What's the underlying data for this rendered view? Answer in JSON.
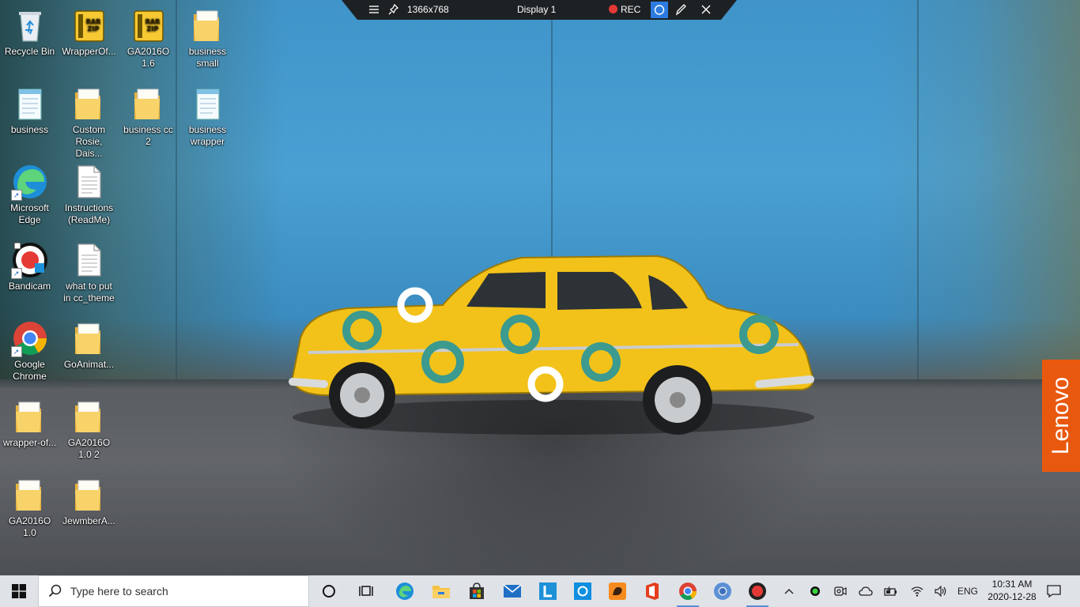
{
  "recorder_bar": {
    "resolution": "1366x768",
    "display": "Display 1",
    "rec_label": "REC"
  },
  "desktop_icons": [
    {
      "label": "Recycle Bin",
      "icon": "recycle-bin-icon"
    },
    {
      "label": "WrapperOf...",
      "icon": "rar-zip-icon"
    },
    {
      "label": "GA2016O 1.6",
      "icon": "rar-zip-icon"
    },
    {
      "label": "business small",
      "icon": "folder-icon"
    },
    {
      "label": "business",
      "icon": "notepad-file-icon"
    },
    {
      "label": "Custom Rosie, Dais...",
      "icon": "folder-icon"
    },
    {
      "label": "business cc 2",
      "icon": "folder-icon"
    },
    {
      "label": "business wrapper",
      "icon": "notepad-file-icon"
    },
    {
      "label": "Microsoft Edge",
      "icon": "edge-icon"
    },
    {
      "label": "Instructions (ReadMe)",
      "icon": "text-file-icon"
    },
    {
      "label": "Bandicam",
      "icon": "bandicam-icon"
    },
    {
      "label": "what to put in cc_theme",
      "icon": "text-file-icon"
    },
    {
      "label": "Google Chrome",
      "icon": "chrome-icon"
    },
    {
      "label": "GoAnimat...",
      "icon": "folder-icon"
    },
    {
      "label": "wrapper-of...",
      "icon": "folder-icon"
    },
    {
      "label": "GA2016O 1.0 2",
      "icon": "folder-icon"
    },
    {
      "label": "GA2016O 1.0",
      "icon": "folder-icon"
    },
    {
      "label": "JewmberA...",
      "icon": "folder-icon"
    }
  ],
  "wallpaper": {
    "brand": "Lenovo"
  },
  "taskbar": {
    "search_placeholder": "Type here to search",
    "apps": [
      "cortana-icon",
      "task-view-icon",
      "edge-icon",
      "file-explorer-icon",
      "store-icon",
      "mail-icon",
      "l-app-icon",
      "cortana-blue-icon",
      "goanimate-icon",
      "office-icon",
      "chrome-icon",
      "chrome-blue-icon",
      "bandicam-record-icon"
    ],
    "tray": {
      "language": "ENG",
      "time": "10:31 AM",
      "date": "2020-12-28"
    }
  },
  "colors": {
    "accent": "#2d7be0",
    "rec_red": "#e53935",
    "lenovo_orange": "#e8590f",
    "taskbar_bg": "#dfe3e8"
  }
}
